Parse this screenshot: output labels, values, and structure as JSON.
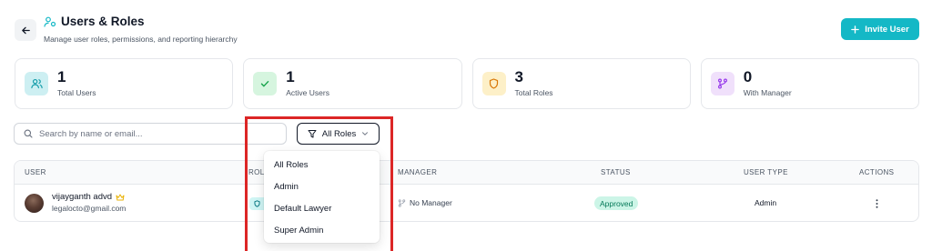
{
  "header": {
    "title": "Users & Roles",
    "subtitle": "Manage user roles, permissions, and reporting hierarchy",
    "invite_label": "Invite User",
    "back_icon": "arrow-left-icon",
    "title_icon": "users-cog-icon"
  },
  "stats": [
    {
      "value": "1",
      "label": "Total Users",
      "icon": "users-icon",
      "color": "#0e9aa7",
      "bg": "#cdeff2"
    },
    {
      "value": "1",
      "label": "Active Users",
      "icon": "check-icon",
      "color": "#16a34a",
      "bg": "#d6f5df"
    },
    {
      "value": "3",
      "label": "Total Roles",
      "icon": "shield-icon",
      "color": "#d97706",
      "bg": "#fdf0c8"
    },
    {
      "value": "0",
      "label": "With Manager",
      "icon": "git-branch-icon",
      "color": "#9333ea",
      "bg": "#f0e0fb"
    }
  ],
  "search": {
    "placeholder": "Search by name or email...",
    "value": ""
  },
  "filter": {
    "selected": "All Roles"
  },
  "table": {
    "columns": {
      "user": "USER",
      "role": "ROLE",
      "manager": "MANAGER",
      "status": "STATUS",
      "user_type": "USER TYPE",
      "actions": "ACTIONS"
    },
    "rows": [
      {
        "name": "vijayganth advd",
        "email": "legalocto@gmail.com",
        "manager": "No Manager",
        "status": "Approved",
        "user_type": "Admin"
      }
    ]
  },
  "dropdown": {
    "options": [
      "All Roles",
      "Admin",
      "Default Lawyer",
      "Super Admin"
    ]
  },
  "colors": {
    "accent": "#14b8c6",
    "highlight": "#dc2626",
    "status_approved_bg": "#ccf5e7",
    "status_approved_text": "#047857"
  }
}
